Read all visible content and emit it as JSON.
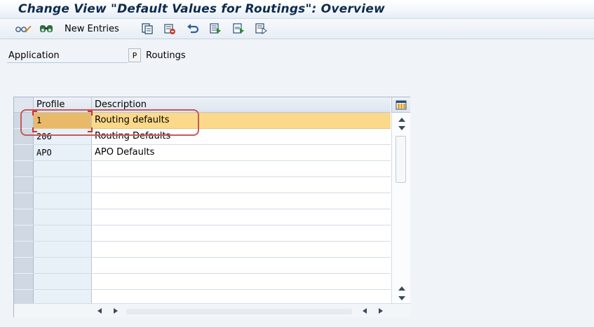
{
  "window": {
    "title": "Change View \"Default Values for Routings\": Overview"
  },
  "toolbar": {
    "display_change_icon": "glasses-pencil-icon",
    "find_icon": "binoculars-icon",
    "new_entries_label": "New Entries",
    "copy_icon": "copy-icon",
    "delete_icon": "delete-icon",
    "undo_icon": "undo-icon",
    "select_all_icon": "select-all-icon",
    "select_block_icon": "select-block-icon",
    "deselect_all_icon": "deselect-all-icon"
  },
  "application": {
    "label": "Application",
    "value": "P",
    "description": "Routings"
  },
  "table": {
    "columns": [
      "Profile",
      "Description"
    ],
    "rows": [
      {
        "profile": "1",
        "description": "Routing defaults",
        "selected": true
      },
      {
        "profile": "206",
        "description": "Routing Defaults",
        "selected": false
      },
      {
        "profile": "APO",
        "description": "APO Defaults",
        "selected": false
      },
      {
        "profile": "",
        "description": "",
        "selected": false
      },
      {
        "profile": "",
        "description": "",
        "selected": false
      },
      {
        "profile": "",
        "description": "",
        "selected": false
      },
      {
        "profile": "",
        "description": "",
        "selected": false
      },
      {
        "profile": "",
        "description": "",
        "selected": false
      },
      {
        "profile": "",
        "description": "",
        "selected": false
      },
      {
        "profile": "",
        "description": "",
        "selected": false
      },
      {
        "profile": "",
        "description": "",
        "selected": false
      },
      {
        "profile": "",
        "description": "",
        "selected": false
      }
    ]
  },
  "colors": {
    "selected_row": "#fbd98a",
    "selected_key_cell": "#e9b96a",
    "highlight_annotation": "#c65a5a",
    "title_text": "#0d2b4c"
  }
}
